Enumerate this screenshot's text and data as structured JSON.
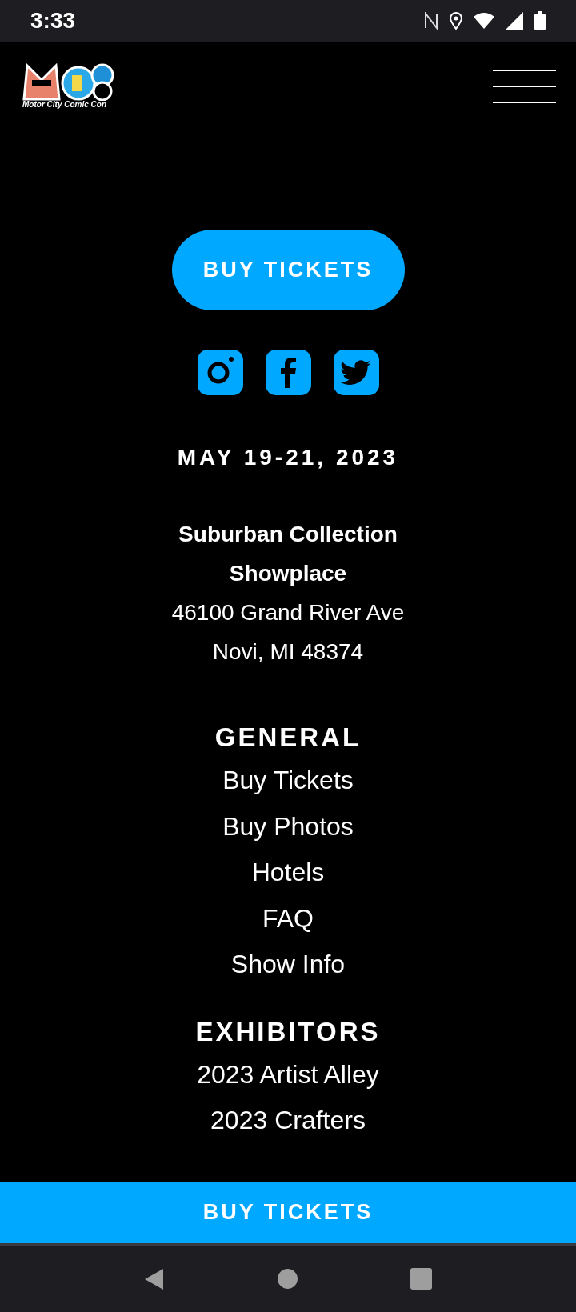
{
  "status_bar": {
    "time": "3:33"
  },
  "header": {
    "logo_tagline": "Motor City Comic Con"
  },
  "hero_button": "BUY TICKETS",
  "social": [
    {
      "kind": "instagram"
    },
    {
      "kind": "facebook"
    },
    {
      "kind": "twitter"
    }
  ],
  "dates": "MAY 19-21, 2023",
  "venue": {
    "name": "Suburban Collection Showplace",
    "street": "46100 Grand River Ave",
    "city": "Novi, MI 48374"
  },
  "sections": [
    {
      "heading": "GENERAL",
      "links": [
        "Buy Tickets",
        "Buy Photos",
        "Hotels",
        "FAQ",
        "Show Info"
      ]
    },
    {
      "heading": "EXHIBITORS",
      "links": [
        "2023 Artist Alley",
        "2023 Crafters"
      ]
    }
  ],
  "sticky_button": "BUY TICKETS"
}
